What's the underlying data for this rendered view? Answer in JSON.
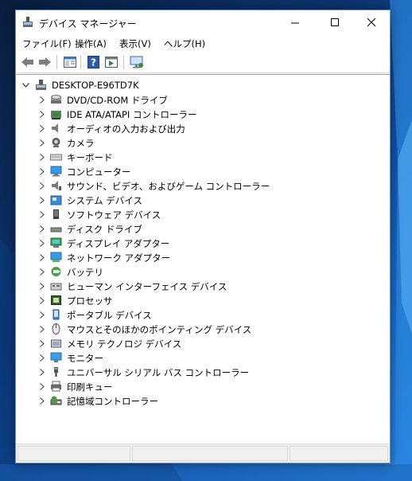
{
  "window": {
    "title": "デバイス マネージャー"
  },
  "menu": [
    "ファイル(F)",
    "操作(A)",
    "表示(V)",
    "ヘルプ(H)"
  ],
  "toolbar": {
    "buttons": [
      "back-icon",
      "forward-icon",
      "properties-view-icon",
      "help-icon",
      "show-hidden-icon",
      "monitor-icon"
    ]
  },
  "tree": {
    "root": "DESKTOP-E96TD7K",
    "items": [
      {
        "label": "DVD/CD-ROM ドライブ",
        "icon": "dvd-drive-icon"
      },
      {
        "label": "IDE ATA/ATAPI コントローラー",
        "icon": "ide-controller-icon"
      },
      {
        "label": "オーディオの入力および出力",
        "icon": "speaker-icon"
      },
      {
        "label": "カメラ",
        "icon": "camera-icon"
      },
      {
        "label": "キーボード",
        "icon": "keyboard-icon"
      },
      {
        "label": "コンピューター",
        "icon": "computer-icon"
      },
      {
        "label": "サウンド、ビデオ、およびゲーム コントローラー",
        "icon": "sound-icon"
      },
      {
        "label": "システム デバイス",
        "icon": "system-device-icon"
      },
      {
        "label": "ソフトウェア デバイス",
        "icon": "software-device-icon"
      },
      {
        "label": "ディスク ドライブ",
        "icon": "disk-drive-icon"
      },
      {
        "label": "ディスプレイ アダプター",
        "icon": "display-adapter-icon"
      },
      {
        "label": "ネットワーク アダプター",
        "icon": "network-adapter-icon"
      },
      {
        "label": "バッテリ",
        "icon": "battery-icon"
      },
      {
        "label": "ヒューマン インターフェイス デバイス",
        "icon": "hid-icon"
      },
      {
        "label": "プロセッサ",
        "icon": "processor-icon"
      },
      {
        "label": "ポータブル デバイス",
        "icon": "portable-device-icon"
      },
      {
        "label": "マウスとそのほかのポインティング デバイス",
        "icon": "mouse-icon"
      },
      {
        "label": "メモリ テクノロジ デバイス",
        "icon": "memory-device-icon"
      },
      {
        "label": "モニター",
        "icon": "monitor-device-icon"
      },
      {
        "label": "ユニバーサル シリアル バス コントローラー",
        "icon": "usb-icon"
      },
      {
        "label": "印刷キュー",
        "icon": "printer-icon"
      },
      {
        "label": "記憶域コントローラー",
        "icon": "storage-controller-icon"
      }
    ]
  },
  "colors": {
    "accent": "#0078d7",
    "window_border": "#6b8fb6"
  }
}
